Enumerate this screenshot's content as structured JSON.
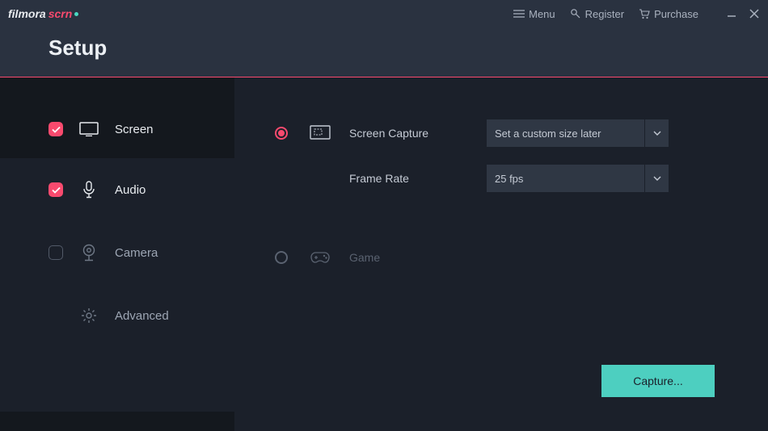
{
  "titlebar": {
    "logo_word1": "filmora",
    "logo_word2": "scrn",
    "menu_label": "Menu",
    "register_label": "Register",
    "purchase_label": "Purchase"
  },
  "header": {
    "title": "Setup"
  },
  "sidebar": {
    "items": [
      {
        "label": "Screen",
        "checked": true
      },
      {
        "label": "Audio",
        "checked": true
      },
      {
        "label": "Camera",
        "checked": false
      },
      {
        "label": "Advanced",
        "checked": null
      }
    ]
  },
  "content": {
    "screen_capture": {
      "label": "Screen Capture",
      "value": "Set a custom size later"
    },
    "frame_rate": {
      "label": "Frame Rate",
      "value": "25 fps"
    },
    "game": {
      "label": "Game"
    },
    "capture_button": "Capture..."
  }
}
